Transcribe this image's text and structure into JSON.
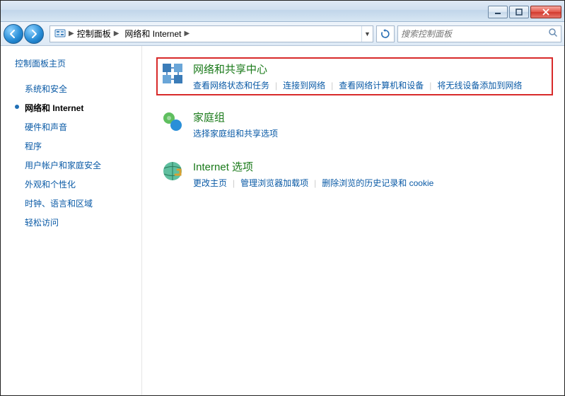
{
  "breadcrumb": {
    "seg1": "控制面板",
    "seg2": "网络和 Internet"
  },
  "search": {
    "placeholder": "搜索控制面板"
  },
  "sidebar": {
    "home": "控制面板主页",
    "items": [
      {
        "label": "系统和安全"
      },
      {
        "label": "网络和 Internet"
      },
      {
        "label": "硬件和声音"
      },
      {
        "label": "程序"
      },
      {
        "label": "用户帐户和家庭安全"
      },
      {
        "label": "外观和个性化"
      },
      {
        "label": "时钟、语言和区域"
      },
      {
        "label": "轻松访问"
      }
    ],
    "active_index": 1
  },
  "categories": [
    {
      "title": "网络和共享中心",
      "highlighted": true,
      "links": [
        "查看网络状态和任务",
        "连接到网络",
        "查看网络计算机和设备",
        "将无线设备添加到网络"
      ]
    },
    {
      "title": "家庭组",
      "highlighted": false,
      "links": [
        "选择家庭组和共享选项"
      ]
    },
    {
      "title": "Internet 选项",
      "highlighted": false,
      "links": [
        "更改主页",
        "管理浏览器加载项",
        "删除浏览的历史记录和 cookie"
      ]
    }
  ]
}
